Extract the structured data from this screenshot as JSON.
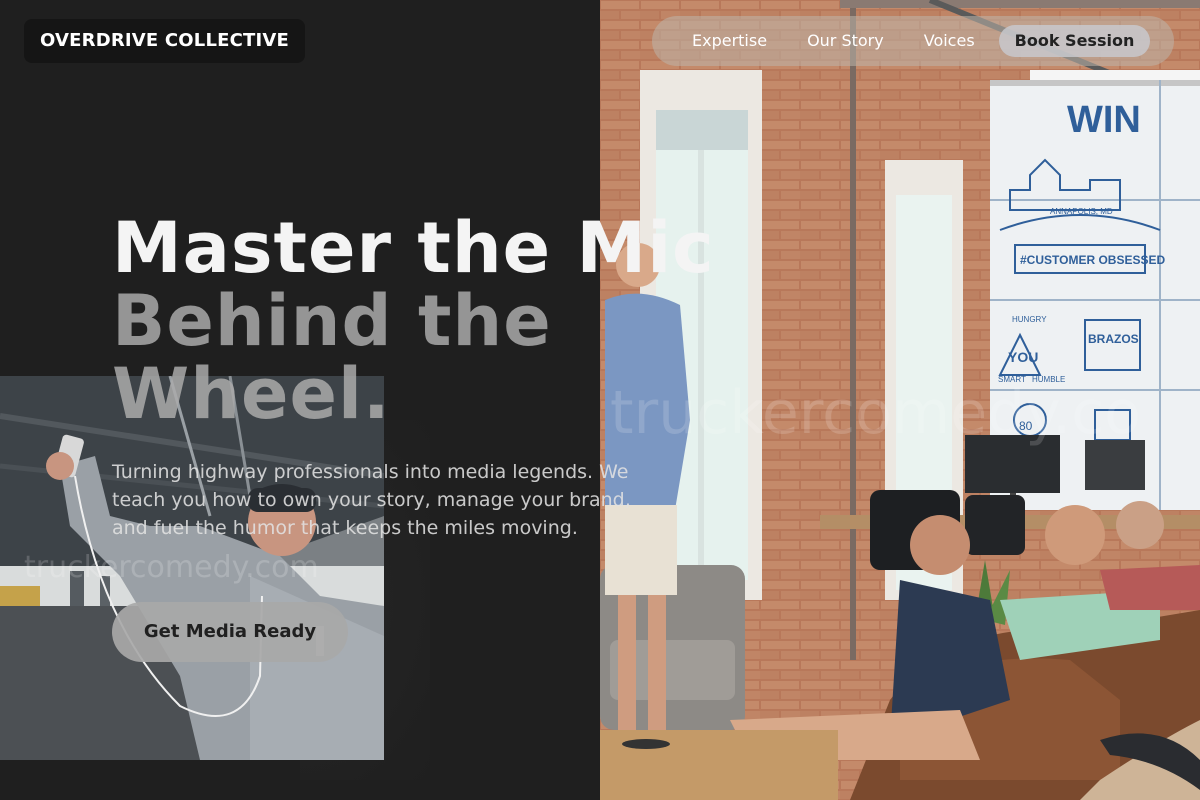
{
  "brand": {
    "name": "OVERDRIVE COLLECTIVE"
  },
  "nav": {
    "links": [
      "Expertise",
      "Our Story",
      "Voices"
    ],
    "cta_label": "Book Session"
  },
  "hero": {
    "headline_line1": "Master the Mic",
    "headline_line2": "Behind the Wheel.",
    "subtext": "Turning highway professionals into media legends. We teach you how to own your story, manage your brand, and fuel the humor that keeps the miles moving.",
    "cta_label": "Get Media Ready"
  },
  "watermarks": {
    "left": "truckercomedy.com",
    "right": "truckercomedy.co"
  },
  "whiteboard": {
    "win": "WIN",
    "city": "ANNAPOLIS, MD",
    "banner": "#CUSTOMER OBSESSED",
    "hungry": "HUNGRY",
    "you": "YOU",
    "smart": "SMART",
    "humble": "HUMBLE",
    "brazos": "BRAZOS",
    "mug_number": "80"
  },
  "colors": {
    "background": "#1f1f1f",
    "accent_gray": "#a8a8a8",
    "brick": "#b97a5a",
    "whiteboard_blue": "#2f5f9a"
  }
}
